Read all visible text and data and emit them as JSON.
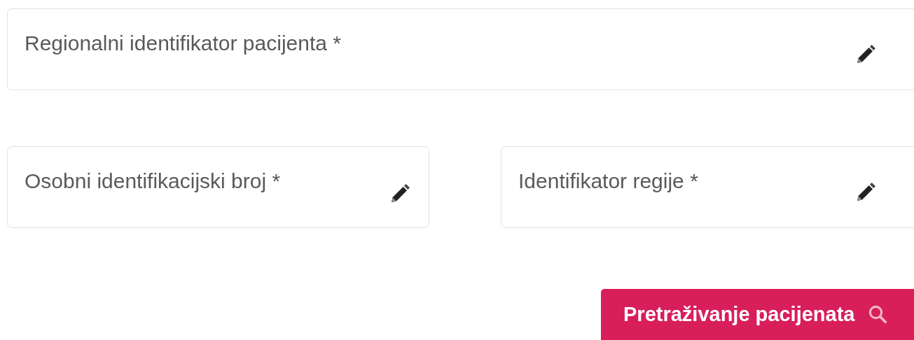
{
  "fields": [
    {
      "placeholder": "Regionalni identifikator pacijenta *",
      "kind": "wide"
    },
    {
      "placeholder": "Osobni identifikacijski broj *",
      "kind": "half"
    },
    {
      "placeholder": "Identifikator regije *",
      "kind": "half"
    }
  ],
  "button": {
    "label": "Pretraživanje pacijenata"
  }
}
